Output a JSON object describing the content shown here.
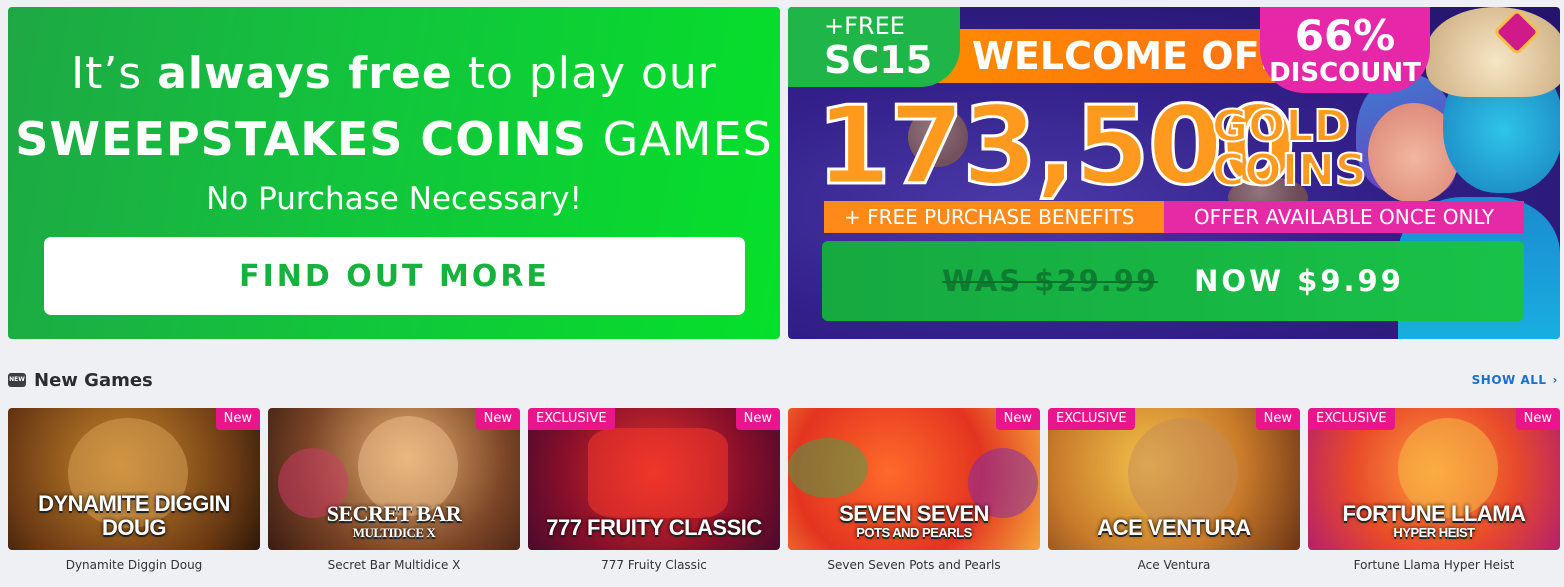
{
  "promo_left": {
    "line1_pre": "It’s ",
    "line1_bold": "always free",
    "line1_post": " to play our",
    "line2_bold": "SWEEPSTAKES COINS",
    "line2_post": " GAMES",
    "subtitle": "No Purchase Necessary!",
    "button_label": "FIND OUT MORE"
  },
  "promo_right": {
    "free_line1": "+FREE",
    "free_line2": "SC15",
    "welcome_label": "WELCOME OFFER",
    "discount_percent": "66%",
    "discount_label": "DISCOUNT",
    "coin_amount": "173,500",
    "gold_line1": "GOLD",
    "gold_line2": "COINS",
    "benefits_label": "+ FREE PURCHASE BENEFITS",
    "once_label": "OFFER AVAILABLE ONCE ONLY",
    "was_price": "WAS $29.99",
    "now_price": "NOW $9.99"
  },
  "section": {
    "icon_text": "NEW",
    "title": "New Games",
    "show_all": "SHOW ALL",
    "chevron": "›"
  },
  "tags": {
    "new": "New",
    "exclusive": "EXCLUSIVE"
  },
  "games": [
    {
      "name": "Dynamite Diggin Doug",
      "art_title": "DYNAMITE DIGGIN DOUG",
      "art_sub": "",
      "exclusive": false
    },
    {
      "name": "Secret Bar Multidice X",
      "art_title": "SECRET BAR",
      "art_sub": "MULTIDICE X",
      "exclusive": false
    },
    {
      "name": "777 Fruity Classic",
      "art_title": "777 FRUITY CLASSIC",
      "art_sub": "",
      "exclusive": true
    },
    {
      "name": "Seven Seven Pots and Pearls",
      "art_title": "SEVEN SEVEN",
      "art_sub": "POTS AND PEARLS",
      "exclusive": false
    },
    {
      "name": "Ace Ventura",
      "art_title": "ACE VENTURA",
      "art_sub": "",
      "exclusive": true
    },
    {
      "name": "Fortune Llama Hyper Heist",
      "art_title": "FORTUNE LLAMA",
      "art_sub": "HYPER HEIST",
      "exclusive": true
    }
  ],
  "colors": {
    "brand_green": "#17b13e",
    "accent_pink": "#e9168b",
    "link_blue": "#1a6fcf",
    "offer_orange": "#ff9a1f"
  }
}
